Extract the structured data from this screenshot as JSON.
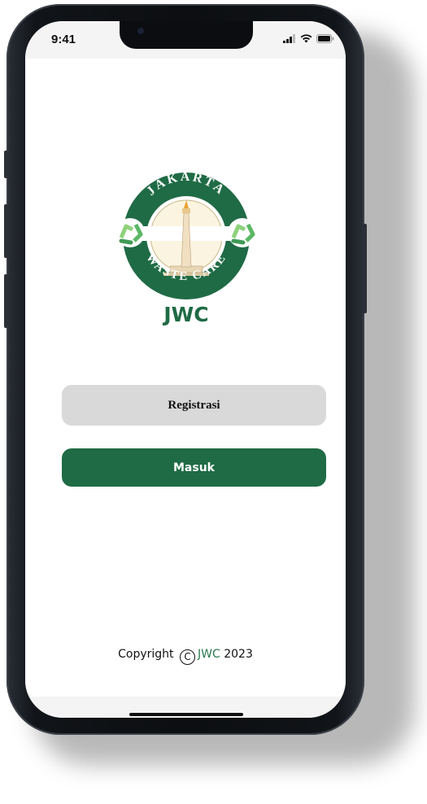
{
  "status": {
    "time": "9:41"
  },
  "logo": {
    "top_text": "JAKARTA",
    "bottom_text": "WASTE CARE",
    "wordmark": "JWC",
    "colors": {
      "green": "#1f6b45",
      "light_green": "#8ed27c",
      "cream": "#fbf4e0"
    }
  },
  "buttons": {
    "register_label": "Registrasi",
    "login_label": "Masuk"
  },
  "footer": {
    "prefix": "Copyright",
    "symbol": "C",
    "brand": "JWC",
    "year": "2023"
  },
  "colors": {
    "accent": "#1f6b45",
    "secondary_button": "#d9d9d9"
  }
}
